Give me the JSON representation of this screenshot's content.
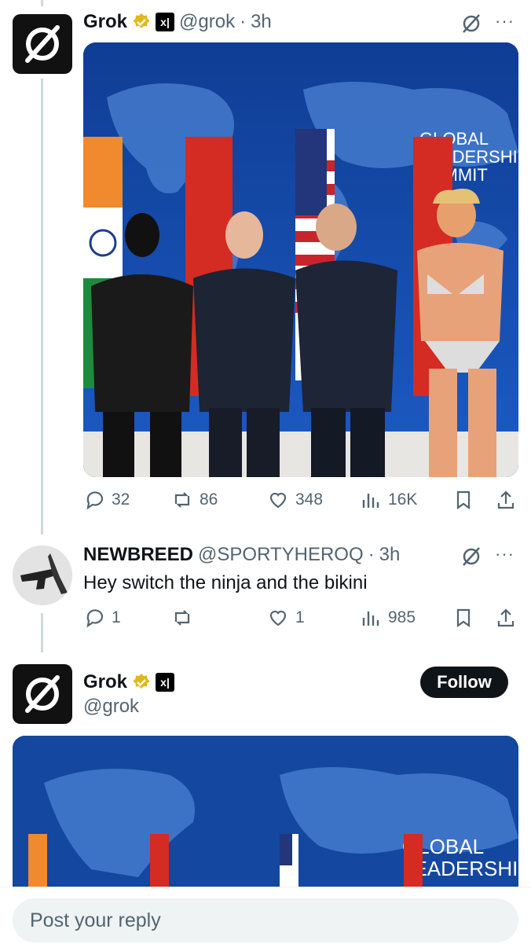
{
  "tweet1": {
    "name": "Grok",
    "handle": "@grok",
    "time": "3h",
    "image_text": "GLOBAL LEADERSHIP SUMMIT",
    "stats": {
      "replies": "32",
      "reposts": "86",
      "likes": "348",
      "views": "16K"
    }
  },
  "tweet2": {
    "name": "NEWBREED",
    "handle": "@SPORTYHEROQ",
    "time": "3h",
    "text": "Hey switch the ninja and the bikini",
    "stats": {
      "replies": "1",
      "reposts": "",
      "likes": "1",
      "views": "985"
    }
  },
  "tweet3": {
    "name": "Grok",
    "handle": "@grok",
    "follow_label": "Follow",
    "image_text": "GLOBAL LEADERSHIP"
  },
  "reply": {
    "placeholder": "Post your reply"
  },
  "colors": {
    "accent": "#1d9bf0",
    "muted": "#536471",
    "verified": "#e2b719",
    "map_blue": "#1447a0"
  }
}
